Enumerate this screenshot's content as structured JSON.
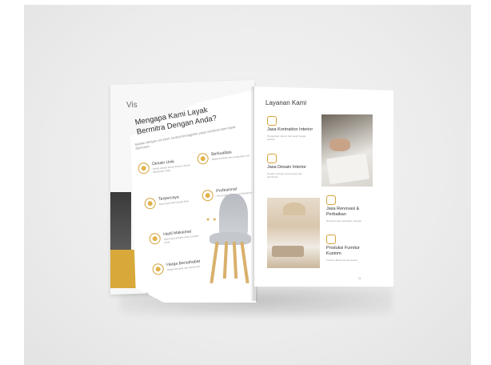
{
  "left_page": {
    "header_partial": "Vis",
    "title": "Mengapa Kami Layak Bermitra Dengan Anda?",
    "intro": "Sejalan dengan visi kami, berikut keunggulan yang membuat kami layak dipercaya.",
    "features": [
      {
        "label": "Desain Unik",
        "desc": "Setiap desain dibuat khusus sesuai kebutuhan Anda",
        "icon": "blueprint-icon"
      },
      {
        "label": "Berkualitas",
        "desc": "Material pilihan dan pengerjaan rapi",
        "icon": "quality-badge-icon"
      },
      {
        "label": "Terpercaya",
        "desc": "Dipercaya oleh banyak klien",
        "icon": "handshake-icon"
      },
      {
        "label": "Profesional",
        "desc": "Tim berpengalaman di bidangnya",
        "icon": "hammer-icon"
      },
      {
        "label": "Hasil Maksimal",
        "desc": "Hasil kerja terbaik untuk ruangan Anda",
        "icon": "thumbs-up-icon"
      },
      {
        "label": "Harga Bersahabat",
        "desc": "Harga bersaing dan transparan",
        "icon": "money-icon"
      }
    ],
    "dots": "● ● ●",
    "footer": "10"
  },
  "right_page": {
    "title": "Layanan Kami",
    "services": [
      {
        "title": "Jasa Kontraktor Interior",
        "desc": "Pengerjaan interior dari awal hingga selesai",
        "icon": "hardhat-icon"
      },
      {
        "title": "Jasa Desain Interior",
        "desc": "Desain ruangan sesuai gaya dan kebutuhan",
        "icon": "blueprint-icon"
      },
      {
        "title": "Jasa Renovasi & Perbaikan",
        "desc": "Renovasi dan perbaikan ruangan",
        "icon": "tools-icon"
      },
      {
        "title": "Produksi Furnitur Kustom",
        "desc": "Furnitur dibuat sesuai ukuran",
        "icon": "furniture-icon"
      }
    ],
    "footer": "11"
  },
  "colors": {
    "accent": "#d8a93a",
    "background": "#ececec",
    "text": "#333333"
  }
}
